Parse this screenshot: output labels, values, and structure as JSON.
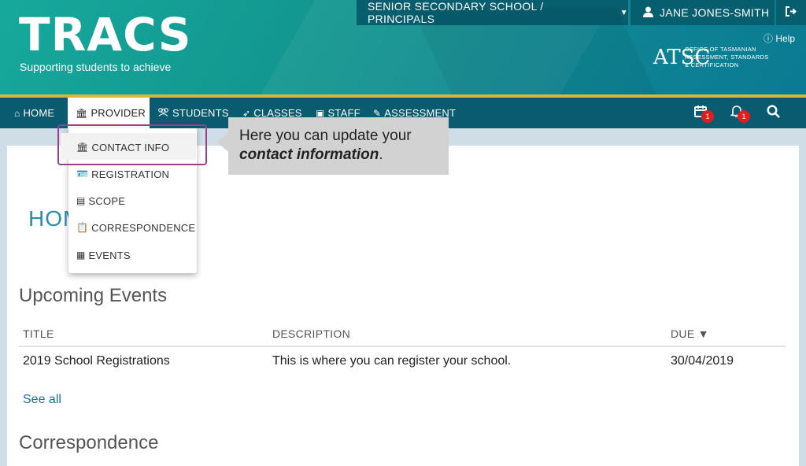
{
  "logo": {
    "name": "TRACS",
    "tagline": "Supporting students to achieve"
  },
  "topbar": {
    "school": "SENIOR SECONDARY SCHOOL / PRINCIPALS",
    "user": "JANE JONES-SMITH",
    "help": "Help"
  },
  "agency": {
    "mark": "ATSC",
    "line1": "OFFICE OF TASMANIAN",
    "line2": "ASSESSMENT, STANDARDS",
    "line3": "& CERTIFICATION"
  },
  "nav": {
    "home": "HOME",
    "provider": "PROVIDER",
    "students": "STUDENTS",
    "classes": "CLASSES",
    "staff": "STAFF",
    "assessment": "ASSESSMENT",
    "calendar_count": "1",
    "notifications_count": "1"
  },
  "dropdown": {
    "items": [
      "CONTACT INFO",
      "REGISTRATION",
      "SCOPE",
      "CORRESPONDENCE",
      "EVENTS"
    ]
  },
  "tooltip": {
    "text_before": "Here you can update your ",
    "text_bold": "contact information",
    "text_after": "."
  },
  "main": {
    "home_heading": "HOME",
    "upcoming_title": "Upcoming Events",
    "columns": {
      "title": "TITLE",
      "description": "DESCRIPTION",
      "due": "DUE ▼"
    },
    "rows": [
      {
        "title": "2019 School Registrations",
        "description": "This is where you can register your school.",
        "due": "30/04/2019"
      }
    ],
    "see_all": "See all",
    "correspondence_title": "Correspondence"
  },
  "colors": {
    "banner": "#12968f",
    "nav": "#0a5a70",
    "accent_gold": "#d8b73a",
    "highlight": "#9c3d8f",
    "badge": "#e11d1d"
  }
}
